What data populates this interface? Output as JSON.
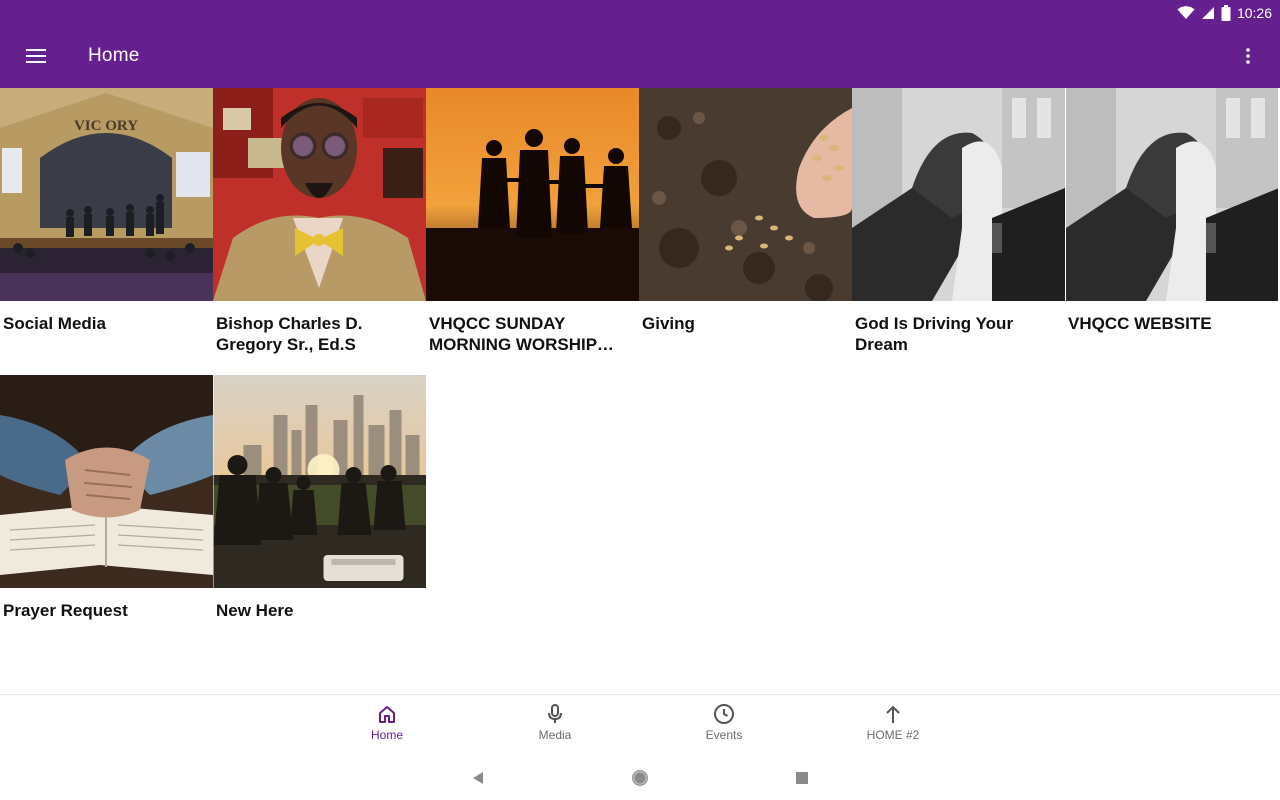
{
  "status": {
    "time": "10:26"
  },
  "appbar": {
    "title": "Home",
    "menu_icon": "hamburger-menu-icon",
    "overflow_icon": "more-vert-icon",
    "color": "#65208f"
  },
  "tiles": [
    {
      "label": "Social Media",
      "image": "church-sanctuary-victory-photo"
    },
    {
      "label": "Bishop Charles D. Gregory Sr., Ed.S",
      "image": "bishop-portrait-photo"
    },
    {
      "label": "VHQCC SUNDAY MORNING WORSHIP SE…",
      "image": "sunset-silhouettes-photo"
    },
    {
      "label": "Giving",
      "image": "hand-sowing-seeds-photo"
    },
    {
      "label": "God Is Driving Your Dream",
      "image": "clasped-hands-bw-photo"
    },
    {
      "label": "VHQCC WEBSITE",
      "image": "clasped-hands-bw-photo"
    },
    {
      "label": "Prayer Request",
      "image": "hands-on-bible-photo"
    },
    {
      "label": "New Here",
      "image": "city-sunset-gathering-photo"
    }
  ],
  "bottom_nav": [
    {
      "label": "Home",
      "icon": "home-icon",
      "active": true
    },
    {
      "label": "Media",
      "icon": "microphone-icon",
      "active": false
    },
    {
      "label": "Events",
      "icon": "clock-icon",
      "active": false
    },
    {
      "label": "HOME #2",
      "icon": "arrow-up-icon",
      "active": false
    }
  ],
  "system_nav": {
    "back": "back-triangle-icon",
    "home": "home-circle-icon",
    "recents": "recents-square-icon"
  }
}
